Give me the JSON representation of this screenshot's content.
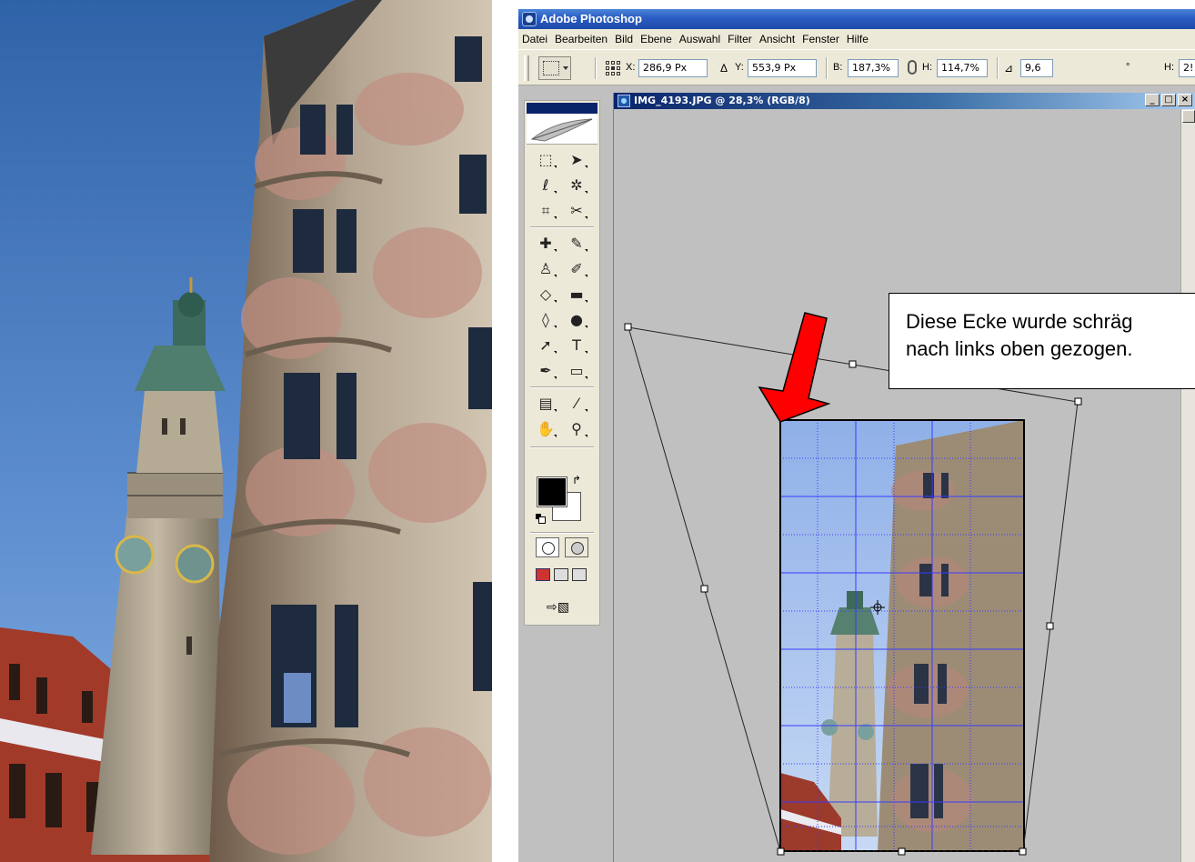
{
  "app": {
    "title": "Adobe Photoshop",
    "colors": {
      "title_bar": "#2a5cc3",
      "doc_title_bar": "#0a246a",
      "canvas_bg": "#c0c0c0",
      "grid_lines": "#3a3aff",
      "arrow": "#ff0000"
    }
  },
  "menu": [
    "Datei",
    "Bearbeiten",
    "Bild",
    "Ebene",
    "Auswahl",
    "Filter",
    "Ansicht",
    "Fenster",
    "Hilfe"
  ],
  "options_bar": {
    "x_label": "X:",
    "x_value": "286,9 Px",
    "delta_icon": "delta-icon",
    "y_label": "Y:",
    "y_value": "553,9 Px",
    "w_label": "B:",
    "w_value": "187,3%",
    "h_label": "H:",
    "h_value": "114,7%",
    "angle_value": "9,6",
    "degree": "°",
    "hskew_label": "H:",
    "hskew_value": "2!"
  },
  "toolbox": {
    "tools": [
      [
        "marquee-icon",
        "move-icon"
      ],
      [
        "lasso-icon",
        "magic-wand-icon"
      ],
      [
        "crop-icon",
        "slice-icon"
      ],
      [
        "healing-brush-icon",
        "brush-icon"
      ],
      [
        "clone-stamp-icon",
        "history-brush-icon"
      ],
      [
        "eraser-icon",
        "gradient-icon"
      ],
      [
        "blur-icon",
        "dodge-icon"
      ],
      [
        "path-selection-icon",
        "type-icon"
      ],
      [
        "pen-icon",
        "shape-icon"
      ],
      [
        "notes-icon",
        "eyedropper-icon"
      ],
      [
        "hand-icon",
        "zoom-icon"
      ]
    ],
    "type_glyph": "T",
    "foreground_color": "#000000",
    "background_color": "#ffffff"
  },
  "document": {
    "title": "IMG_4193.JPG @ 28,3% (RGB/8)",
    "minimize": "_",
    "maximize": "□",
    "close": "×"
  },
  "callout": {
    "text": "Diese Ecke wurde schräg\nnach links oben gezogen."
  }
}
